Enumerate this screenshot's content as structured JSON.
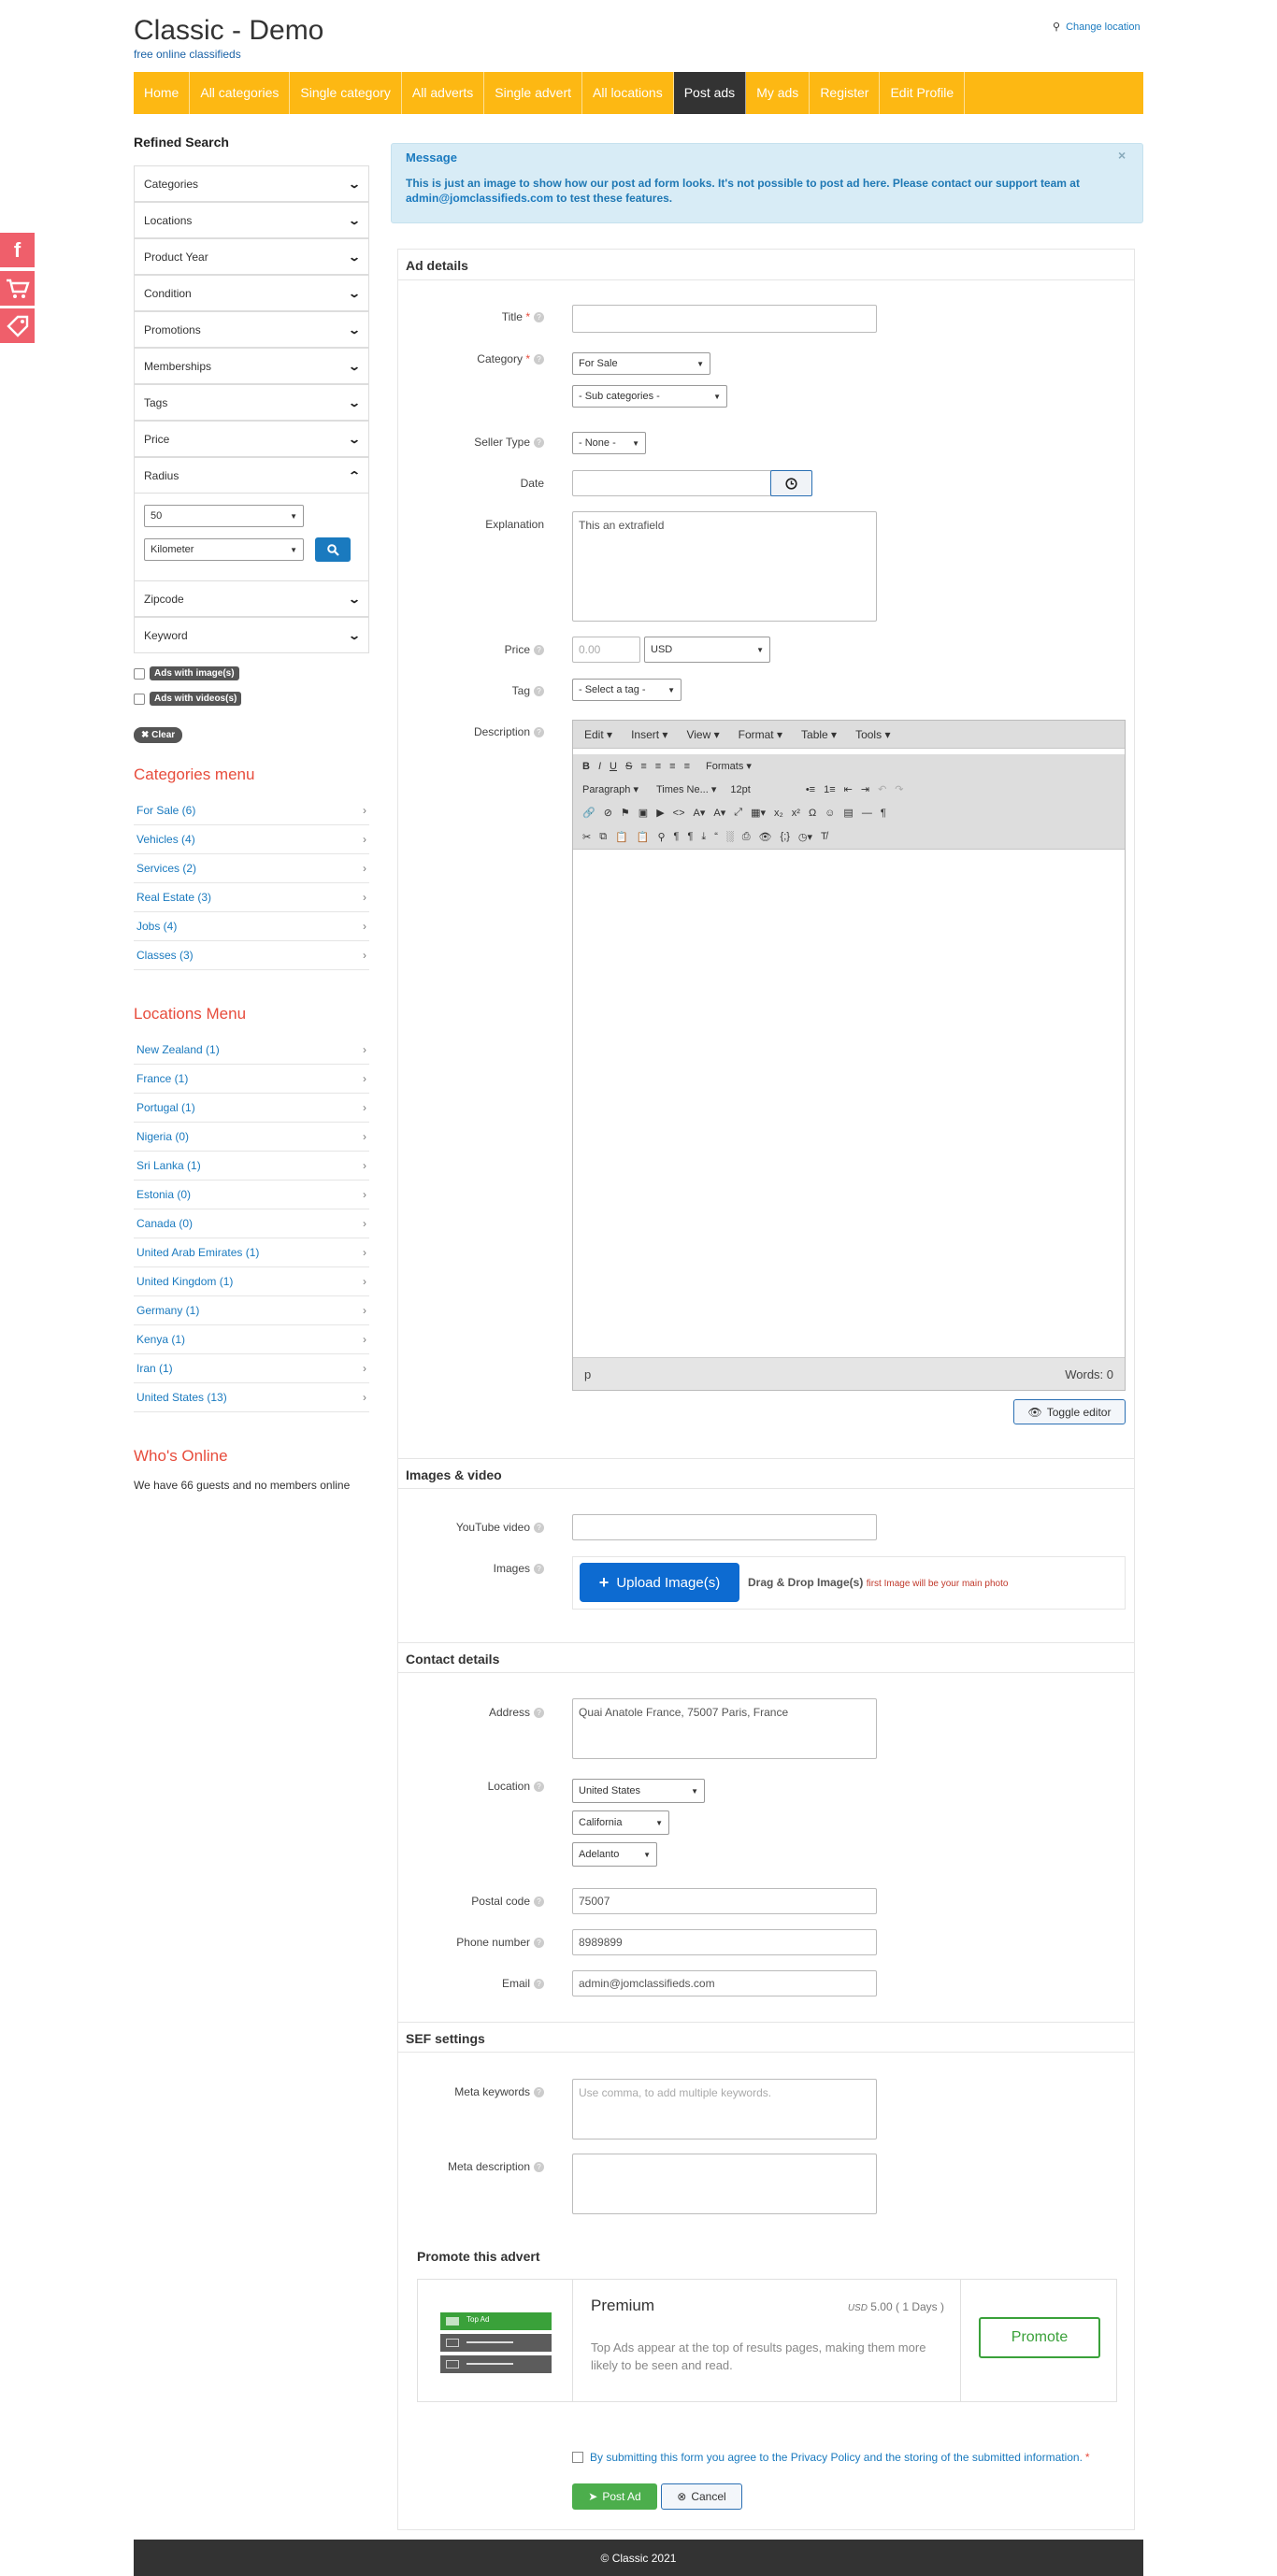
{
  "header": {
    "title": "Classic - Demo",
    "subtitle": "free online classifieds",
    "change_location": "Change location"
  },
  "nav": [
    "Home",
    "All categories",
    "Single category",
    "All adverts",
    "Single advert",
    "All locations",
    "Post ads",
    "My ads",
    "Register",
    "Edit Profile"
  ],
  "nav_active": "Post ads",
  "colors": {
    "nav": "#fdb813",
    "accent": "#1a7abf",
    "heading_red": "#e74c3c",
    "promote_green": "#3aa13a"
  },
  "social": [
    "facebook-icon",
    "cart-icon",
    "tag-icon"
  ],
  "sidebar": {
    "refined_title": "Refined Search",
    "filters": [
      "Categories",
      "Locations",
      "Product Year",
      "Condition",
      "Promotions",
      "Memberships",
      "Tags",
      "Price",
      "Radius"
    ],
    "radius_value": "50",
    "radius_unit": "Kilometer",
    "filters_after": [
      "Zipcode",
      "Keyword"
    ],
    "ads_with_images": "Ads with image(s)",
    "ads_with_videos": "Ads with videos(s)",
    "clear": "Clear",
    "categories_title": "Categories menu",
    "categories": [
      "For Sale (6)",
      "Vehicles (4)",
      "Services (2)",
      "Real Estate (3)",
      "Jobs (4)",
      "Classes (3)"
    ],
    "locations_title": "Locations Menu",
    "locations": [
      "New Zealand (1)",
      "France (1)",
      "Portugal (1)",
      "Nigeria (0)",
      "Sri Lanka (1)",
      "Estonia (0)",
      "Canada (0)",
      "United Arab Emirates (1)",
      "United Kingdom (1)",
      "Germany (1)",
      "Kenya (1)",
      "Iran (1)",
      "United States (13)"
    ],
    "whos_online_title": "Who's Online",
    "whos_online_text": "We have 66 guests and no members online"
  },
  "message": {
    "title": "Message",
    "text_prefix": "This is just an image to show how our post ad form looks. It's not possible to post ad here. Please contact our support team at ",
    "email": "admin@jomclassifieds.com",
    "text_suffix": " to test these features.",
    "close": "×"
  },
  "ad_details": {
    "heading": "Ad details",
    "title_label": "Title",
    "category_label": "Category",
    "category_value": "For Sale",
    "subcategory_value": "- Sub categories -",
    "seller_type_label": "Seller Type",
    "seller_type_value": "- None -",
    "date_label": "Date",
    "explanation_label": "Explanation",
    "explanation_value": "This an extrafield",
    "price_label": "Price",
    "price_placeholder": "0.00",
    "currency_value": "USD",
    "tag_label": "Tag",
    "tag_value": "- Select a tag -",
    "description_label": "Description"
  },
  "editor": {
    "menus": [
      "Edit",
      "Insert",
      "View",
      "Format",
      "Table",
      "Tools"
    ],
    "formats_label": "Formats",
    "paragraph": "Paragraph",
    "font": "Times Ne...",
    "size": "12pt",
    "path": "p",
    "words": "Words: 0",
    "toggle": "Toggle editor"
  },
  "images_video": {
    "heading": "Images & video",
    "youtube_label": "YouTube video",
    "images_label": "Images",
    "upload": "Upload Image(s)",
    "dnd": "Drag & Drop Image(s)",
    "dnd_note": "first Image will be your main photo"
  },
  "contact": {
    "heading": "Contact details",
    "address_label": "Address",
    "address_value": "Quai Anatole France, 75007 Paris, France",
    "location_label": "Location",
    "country": "United States",
    "state": "California",
    "city": "Adelanto",
    "postal_label": "Postal code",
    "postal_value": "75007",
    "phone_label": "Phone number",
    "phone_value": "8989899",
    "email_label": "Email",
    "email_value": "admin@jomclassifieds.com"
  },
  "sef": {
    "heading": "SEF settings",
    "meta_keywords_label": "Meta keywords",
    "meta_keywords_placeholder": "Use comma, to add multiple keywords.",
    "meta_description_label": "Meta description"
  },
  "promote": {
    "heading": "Promote this advert",
    "image_label": "Top Ad",
    "name": "Premium",
    "currency": "USD",
    "price": "5.00 ( 1 Days )",
    "description": "Top Ads appear at the top of results pages, making them more likely to be seen and read.",
    "button": "Promote"
  },
  "consent": "By submitting this form you agree to the Privacy Policy and the storing of the submitted information.",
  "buttons": {
    "post_ad": "Post Ad",
    "cancel": "Cancel"
  },
  "footer": "© Classic 2021"
}
